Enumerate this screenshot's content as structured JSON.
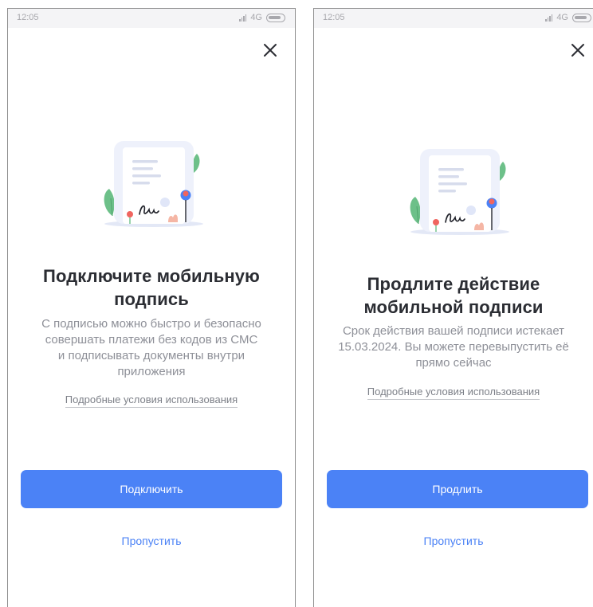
{
  "screens": [
    {
      "status": {
        "time": "12:05",
        "network": "4G"
      },
      "title": "Подключите мобильную\nподпись",
      "description": "С подписью можно быстро и безопасно\nсовершать платежи без кодов из СМС\nи подписывать документы внутри\nприложения",
      "terms_link": "Подробные условия использования",
      "primary_button": "Подключить",
      "skip_link": "Пропустить"
    },
    {
      "status": {
        "time": "12:05",
        "network": "4G"
      },
      "title": "Продлите действие\nмобильной подписи",
      "description": "Срок действия вашей подписи истекает\n15.03.2024. Вы можете перевыпустить её\nпрямо сейчас",
      "terms_link": "Подробные условия использования",
      "primary_button": "Продлить",
      "skip_link": "Пропустить"
    }
  ],
  "icons": {
    "close": "close-icon",
    "signal": "signal-icon",
    "battery": "battery-icon",
    "illustration": "signed-document-illustration"
  },
  "colors": {
    "accent": "#4b82f6",
    "title": "#2b2d33",
    "text_secondary": "#8e9098",
    "status_bar": "#f4f4f6"
  }
}
